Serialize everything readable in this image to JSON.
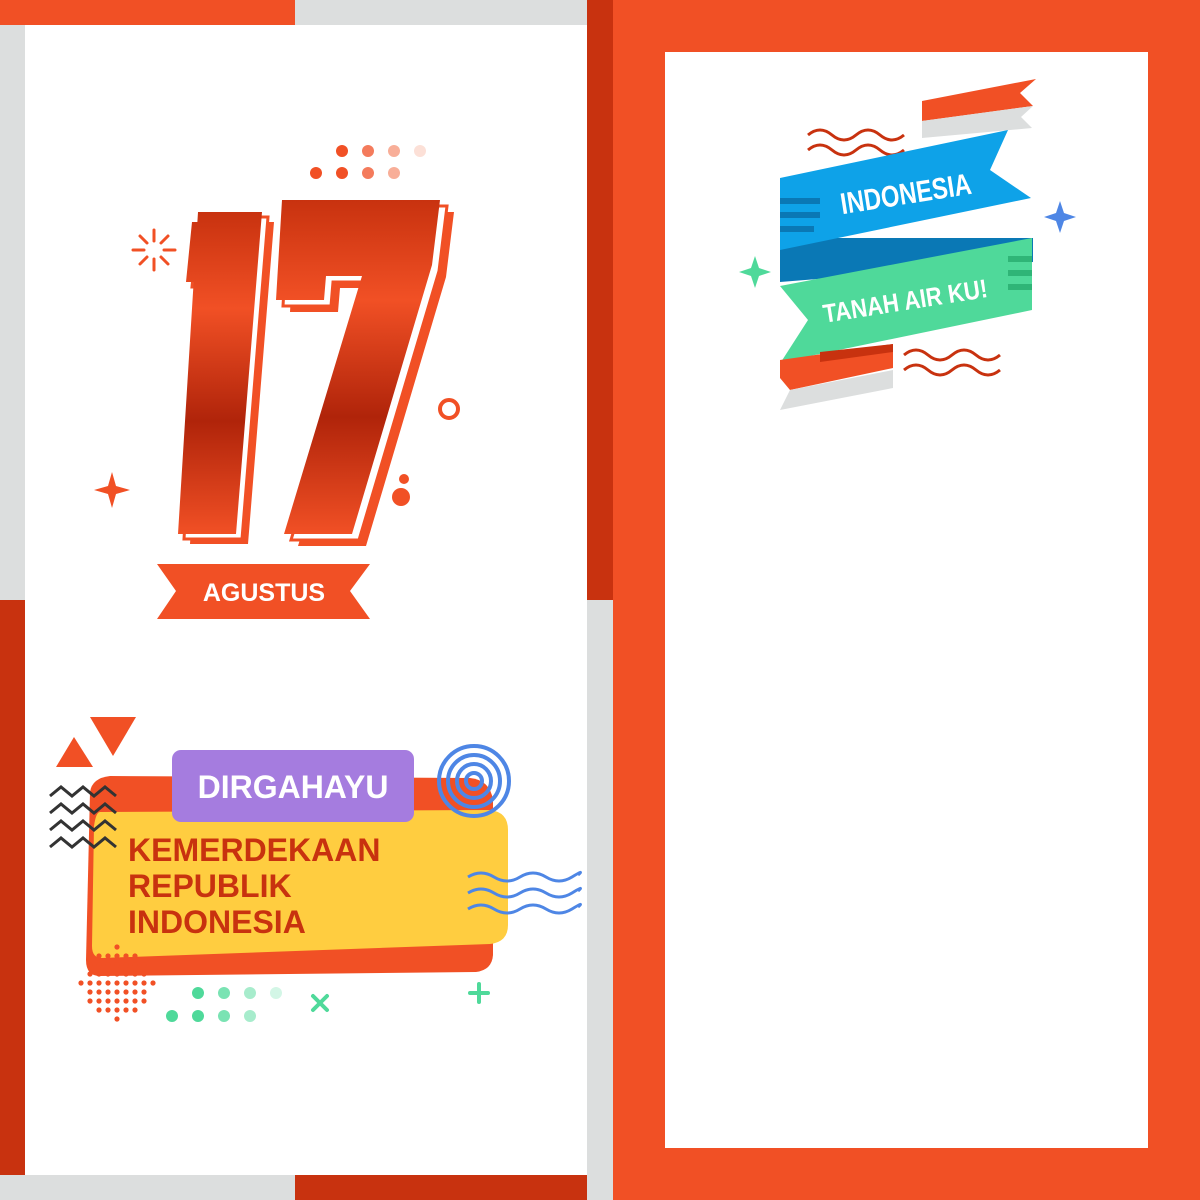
{
  "colors": {
    "orange": "#F15025",
    "dark_red": "#C8320F",
    "grey": "#DCDEDE",
    "blue": "#0EA2E8",
    "green": "#4FD99A",
    "yellow": "#FFCD40",
    "purple": "#A57CDF",
    "circle_blue": "#4E86E5"
  },
  "left_panel": {
    "date_number": "17",
    "month_ribbon": "AGUSTUS",
    "greeting_tag": "DIRGAHAYU",
    "greeting_lines": [
      "KEMERDEKAAN",
      "REPUBLIK",
      "INDONESIA"
    ]
  },
  "right_panel": {
    "ribbon_top": "INDONESIA",
    "ribbon_bottom": "TANAH AIR KU!"
  }
}
